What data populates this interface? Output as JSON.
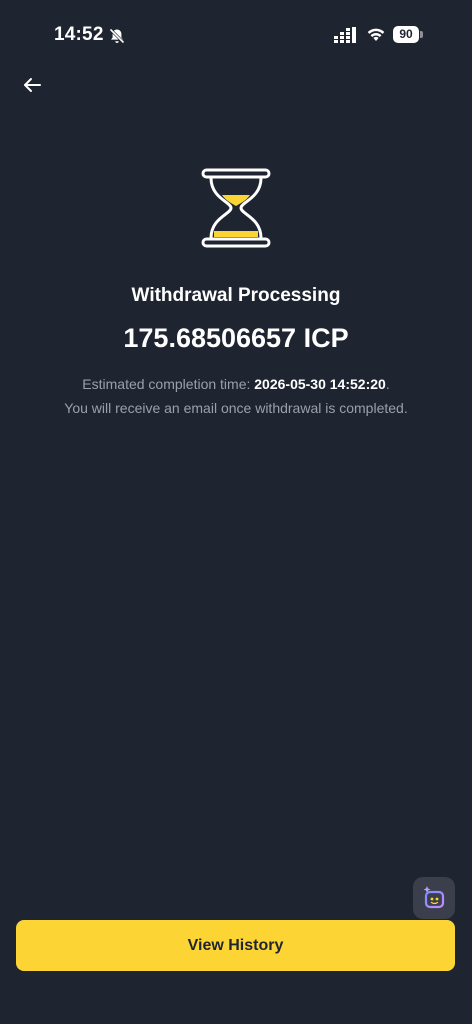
{
  "status_bar": {
    "time": "14:52",
    "battery": "90"
  },
  "main": {
    "title": "Withdrawal Processing",
    "amount": "175.68506657 ICP",
    "estimated_prefix": "Estimated completion time: ",
    "estimated_time": "2026-05-30 14:52:20",
    "estimated_suffix": ".",
    "email_note": "You will receive an email once withdrawal is completed."
  },
  "footer": {
    "view_history_label": "View History"
  },
  "icons": {
    "back": "arrow-left-icon",
    "hourglass": "hourglass-icon",
    "assistant": "assistant-bot-icon"
  },
  "colors": {
    "background": "#1f2530",
    "accent": "#fcd535",
    "muted_text": "#9aa0ab"
  }
}
